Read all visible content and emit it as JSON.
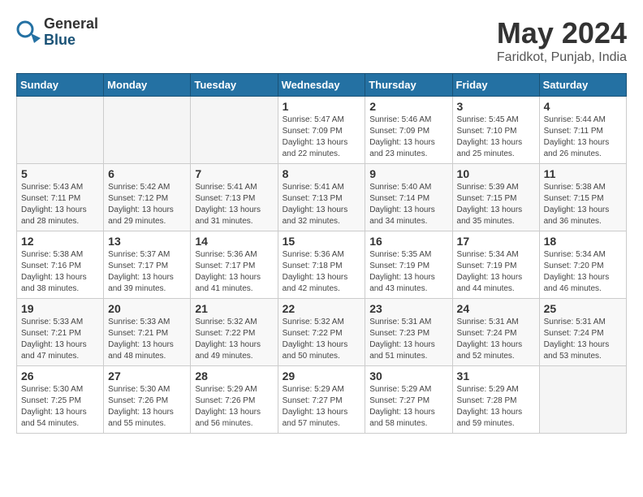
{
  "logo": {
    "general": "General",
    "blue": "Blue"
  },
  "title": "May 2024",
  "location": "Faridkot, Punjab, India",
  "days_of_week": [
    "Sunday",
    "Monday",
    "Tuesday",
    "Wednesday",
    "Thursday",
    "Friday",
    "Saturday"
  ],
  "weeks": [
    [
      {
        "day": "",
        "info": ""
      },
      {
        "day": "",
        "info": ""
      },
      {
        "day": "",
        "info": ""
      },
      {
        "day": "1",
        "info": "Sunrise: 5:47 AM\nSunset: 7:09 PM\nDaylight: 13 hours\nand 22 minutes."
      },
      {
        "day": "2",
        "info": "Sunrise: 5:46 AM\nSunset: 7:09 PM\nDaylight: 13 hours\nand 23 minutes."
      },
      {
        "day": "3",
        "info": "Sunrise: 5:45 AM\nSunset: 7:10 PM\nDaylight: 13 hours\nand 25 minutes."
      },
      {
        "day": "4",
        "info": "Sunrise: 5:44 AM\nSunset: 7:11 PM\nDaylight: 13 hours\nand 26 minutes."
      }
    ],
    [
      {
        "day": "5",
        "info": "Sunrise: 5:43 AM\nSunset: 7:11 PM\nDaylight: 13 hours\nand 28 minutes."
      },
      {
        "day": "6",
        "info": "Sunrise: 5:42 AM\nSunset: 7:12 PM\nDaylight: 13 hours\nand 29 minutes."
      },
      {
        "day": "7",
        "info": "Sunrise: 5:41 AM\nSunset: 7:13 PM\nDaylight: 13 hours\nand 31 minutes."
      },
      {
        "day": "8",
        "info": "Sunrise: 5:41 AM\nSunset: 7:13 PM\nDaylight: 13 hours\nand 32 minutes."
      },
      {
        "day": "9",
        "info": "Sunrise: 5:40 AM\nSunset: 7:14 PM\nDaylight: 13 hours\nand 34 minutes."
      },
      {
        "day": "10",
        "info": "Sunrise: 5:39 AM\nSunset: 7:15 PM\nDaylight: 13 hours\nand 35 minutes."
      },
      {
        "day": "11",
        "info": "Sunrise: 5:38 AM\nSunset: 7:15 PM\nDaylight: 13 hours\nand 36 minutes."
      }
    ],
    [
      {
        "day": "12",
        "info": "Sunrise: 5:38 AM\nSunset: 7:16 PM\nDaylight: 13 hours\nand 38 minutes."
      },
      {
        "day": "13",
        "info": "Sunrise: 5:37 AM\nSunset: 7:17 PM\nDaylight: 13 hours\nand 39 minutes."
      },
      {
        "day": "14",
        "info": "Sunrise: 5:36 AM\nSunset: 7:17 PM\nDaylight: 13 hours\nand 41 minutes."
      },
      {
        "day": "15",
        "info": "Sunrise: 5:36 AM\nSunset: 7:18 PM\nDaylight: 13 hours\nand 42 minutes."
      },
      {
        "day": "16",
        "info": "Sunrise: 5:35 AM\nSunset: 7:19 PM\nDaylight: 13 hours\nand 43 minutes."
      },
      {
        "day": "17",
        "info": "Sunrise: 5:34 AM\nSunset: 7:19 PM\nDaylight: 13 hours\nand 44 minutes."
      },
      {
        "day": "18",
        "info": "Sunrise: 5:34 AM\nSunset: 7:20 PM\nDaylight: 13 hours\nand 46 minutes."
      }
    ],
    [
      {
        "day": "19",
        "info": "Sunrise: 5:33 AM\nSunset: 7:21 PM\nDaylight: 13 hours\nand 47 minutes."
      },
      {
        "day": "20",
        "info": "Sunrise: 5:33 AM\nSunset: 7:21 PM\nDaylight: 13 hours\nand 48 minutes."
      },
      {
        "day": "21",
        "info": "Sunrise: 5:32 AM\nSunset: 7:22 PM\nDaylight: 13 hours\nand 49 minutes."
      },
      {
        "day": "22",
        "info": "Sunrise: 5:32 AM\nSunset: 7:22 PM\nDaylight: 13 hours\nand 50 minutes."
      },
      {
        "day": "23",
        "info": "Sunrise: 5:31 AM\nSunset: 7:23 PM\nDaylight: 13 hours\nand 51 minutes."
      },
      {
        "day": "24",
        "info": "Sunrise: 5:31 AM\nSunset: 7:24 PM\nDaylight: 13 hours\nand 52 minutes."
      },
      {
        "day": "25",
        "info": "Sunrise: 5:31 AM\nSunset: 7:24 PM\nDaylight: 13 hours\nand 53 minutes."
      }
    ],
    [
      {
        "day": "26",
        "info": "Sunrise: 5:30 AM\nSunset: 7:25 PM\nDaylight: 13 hours\nand 54 minutes."
      },
      {
        "day": "27",
        "info": "Sunrise: 5:30 AM\nSunset: 7:26 PM\nDaylight: 13 hours\nand 55 minutes."
      },
      {
        "day": "28",
        "info": "Sunrise: 5:29 AM\nSunset: 7:26 PM\nDaylight: 13 hours\nand 56 minutes."
      },
      {
        "day": "29",
        "info": "Sunrise: 5:29 AM\nSunset: 7:27 PM\nDaylight: 13 hours\nand 57 minutes."
      },
      {
        "day": "30",
        "info": "Sunrise: 5:29 AM\nSunset: 7:27 PM\nDaylight: 13 hours\nand 58 minutes."
      },
      {
        "day": "31",
        "info": "Sunrise: 5:29 AM\nSunset: 7:28 PM\nDaylight: 13 hours\nand 59 minutes."
      },
      {
        "day": "",
        "info": ""
      }
    ]
  ]
}
